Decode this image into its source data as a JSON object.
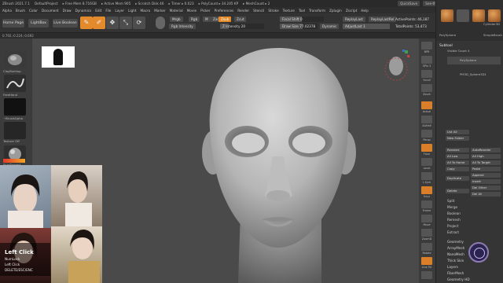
{
  "titlebar": {
    "app": "ZBrush 2021.7.1",
    "project": "DefaultProject",
    "stats": [
      "▸ Free Mem 8.716GB",
      "▸ Active Mem 905",
      "▸ Scratch Disk 46",
      "▸ Timer ▸ 0.023",
      "▸ PolyCount ▸ 34.245 KP",
      "▸ MeshCount ▸ 2"
    ],
    "quicksave": "QuickSave",
    "seethrough": "See-through 0",
    "menus": "Menus",
    "script": "DefaultZScript"
  },
  "menubar": [
    "Alpha",
    "Brush",
    "Color",
    "Document",
    "Draw",
    "Dynamics",
    "Edit",
    "File",
    "Layer",
    "Light",
    "Macro",
    "Marker",
    "Material",
    "Movie",
    "Picker",
    "Preferences",
    "Render",
    "Stencil",
    "Stroke",
    "Texture",
    "Tool",
    "Transform",
    "Zplugin",
    "Zscript",
    "Help"
  ],
  "shelf": {
    "home": "Home Page",
    "lightbox": "LightBox",
    "live_boolean": "Live Boolean",
    "tools": [
      {
        "label": "Edit",
        "glyph": "✎"
      },
      {
        "label": "Draw",
        "glyph": "✐"
      },
      {
        "label": "Move",
        "glyph": "✥"
      },
      {
        "label": "Scale",
        "glyph": "⤡"
      },
      {
        "label": "Rotate",
        "glyph": "⟳"
      }
    ],
    "mrgb": "Mrgb",
    "rgb": "Rgb",
    "m": "M",
    "zadd": "Zadd",
    "zsub": "Zsub",
    "zcut": "Zcut",
    "rgb_intensity": "Rgb Intensity",
    "z_intensity": "Z Intensity 20",
    "focal_shift": "Focal Shift 0",
    "draw_size": "Draw Size 77.02378",
    "dynamic": "Dynamic",
    "replay_last": "ReplayLast",
    "replay_last_rel": "ReplayLastRel",
    "adjust_last": "AdjustLast 1",
    "active_points": "ActivePoints: 46,187",
    "total_points": "TotalPoints: 53,473"
  },
  "infobar": "0.792,-0.224,-0.692",
  "left": {
    "brush_label": "ClayBuildup",
    "stroke_label": "FreeHand",
    "alpha_label": "~BrushAlpha",
    "texture_label": "Texture Off",
    "material_label": "SkinShade4",
    "gradient_label": "Gradient",
    "switch_label": "SwitchColor",
    "alternate_label": "Alternate"
  },
  "overlay": {
    "title": "Left Click",
    "line1": "NumLock",
    "line2": "Left Click",
    "line3": "DELETE/ESC/ENC"
  },
  "rightstrip": [
    "BPR",
    "SPix 3",
    "Scroll",
    "Zoom",
    "Actual",
    "AAHalf",
    "Persp",
    "Floor",
    "Local",
    "L.Sym",
    "Gxyz",
    "Frame",
    "Move",
    "ZoomD",
    "Rotate",
    "Line Fill",
    "PolyF",
    "Transp",
    "Ghost",
    "Solo",
    "Xpose"
  ],
  "rightpanel": {
    "thumbs": [
      "PolySphere",
      "Cylinder3D",
      "PolySphere",
      "SimpleBrush"
    ],
    "subtool_title": "Subtool",
    "visible_count": "Visible Count 4",
    "subtools": [
      "PolySphere",
      "PM3D_Sphere3D1"
    ],
    "list_all": "List All",
    "new_folder": "New Folder",
    "buttons_left": [
      "Rename",
      "All Low",
      "All To Home",
      "Copy",
      "Duplicate",
      "Delete",
      "Split",
      "Merge",
      "Boolean",
      "Remesh",
      "Project",
      "Extract"
    ],
    "buttons_right": [
      "AutoReorder",
      "All High",
      "All To Target",
      "Paste",
      "Append",
      "Insert",
      "Del Other",
      "Del All"
    ],
    "sections": [
      "Geometry",
      "ArrayMesh",
      "NanoMesh",
      "Thick Skin",
      "Layers",
      "FiberMesh",
      "Geometry HD"
    ]
  },
  "colors": {
    "accent": "#e38a2c",
    "panel_bg": "#353535",
    "canvas_bg": "#4a4a4a",
    "logo": "#2b2450"
  }
}
